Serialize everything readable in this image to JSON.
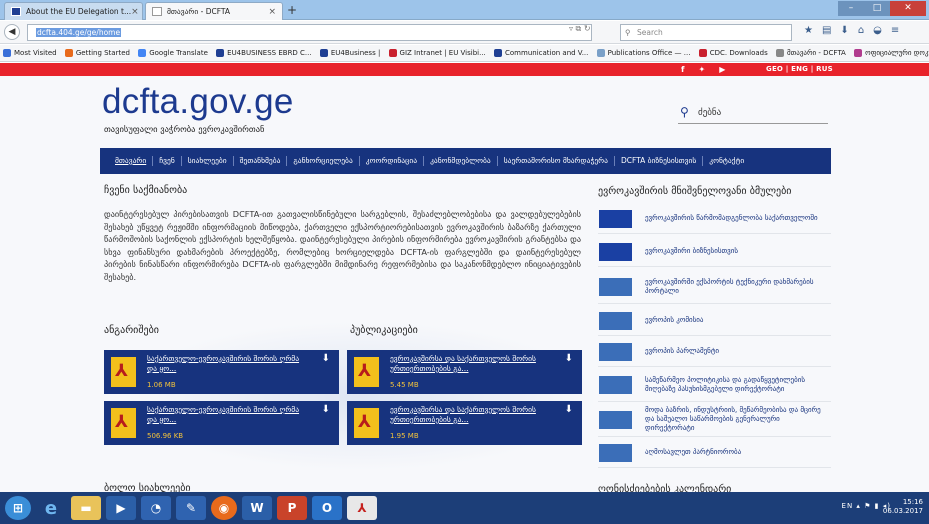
{
  "browser": {
    "tabs": [
      {
        "label": "About the EU Delegation t..."
      },
      {
        "label": "მთავარი - DCFTA"
      }
    ],
    "url": "dcfta.404.ge/ge/home",
    "search_placeholder": "Search",
    "bookmarks": [
      "Most Visited",
      "Getting Started",
      "Google Translate",
      "EU4BUSINESS EBRD C...",
      "EU4Business |",
      "GIZ Intranet | EU Visibi...",
      "Communication and V...",
      "Publications Office — ...",
      "CDC. Downloads",
      "მთავარი - DCFTA",
      "ოფიციალური დოკუ..."
    ]
  },
  "site": {
    "lang_switch": "GEO | ENG | RUS",
    "logo": "dcfta.gov.ge",
    "tagline": "თავისუფალი ვაჭრობა ევროკავშირთან",
    "search_label": "ძებნა",
    "nav": [
      "მთავარი",
      "ჩვენ",
      "სიახლეები",
      "შეთანხმება",
      "განხორციელება",
      "კოორდინაცია",
      "კანონმდებლობა",
      "საერთაშორისო მხარდაჭერა",
      "DCFTA ბიზნესისთვის",
      "კონტაქტი"
    ],
    "about_heading": "ჩვენი საქმიანობა",
    "about_text": "დაინტერესებულ პირებისათვის DCFTA-ით გათვალისწინებული სარგებლის, შესაძლებლობებისა და ვალდებულებების შესახებ უწყვეტ რეჟიმში ინფორმაციის მიწოდება, ქართველი ექსპორტიორებისათვის ევროკავშირის ბაზარზე ქართული წარმოშობის საქონლის ექსპორტის ხელშეწყობა. დაინტერესებული პირების ინფორმირება ევროკავშირის გრანტებსა და სხვა ფინანსური დახმარების პროექტებზე, რომლებიც ხორციელდება DCFTA-ის ფარგლებში და დაინტერესებულ პირების ნინასწარი ინფორმირება DCFTA-ის ფარგლებში მიმდინარე რეფორმებისა და საკანონმდებლო ინიციატივების შესახებ.",
    "reports_heading": "ანგარიშები",
    "pubs_heading": "პუბლიკაციები",
    "downloads": [
      {
        "title": "საქართველო-ევროკავშირის შორის ღრმა და ყო...",
        "size": "1.06 MB"
      },
      {
        "title": "ევროკავშირსა და საქართველოს შორის ურთიერთობების გა...",
        "size": "5.45 MB"
      },
      {
        "title": "საქართველო-ევროკავშირის შორის ღრმა და ყო...",
        "size": "506.96 KB"
      },
      {
        "title": "ევროკავშირსა და საქართველოს შორის ურთიერთობების გა...",
        "size": "1.95 MB"
      }
    ],
    "right_heading": "ევროკავშირის მნიშვნელოვანი ბმულები",
    "right_links": [
      "ევროკავშირის წარმომადგენლობა საქართველოში",
      "ევროკავშირი ბიზნესისთვის",
      "ევროკავშირში ექსპორტის ტექნიკური დახმარების პორტალი",
      "ევროპის კომისია",
      "ევროპის პარლამენტი",
      "სამეწარმეო პოლიტიკისა და გადაწყვეტილების მიღებაზე პასუხისმგებელი დირექტორატი",
      "მოდა ბაზრის, ინდუსტრიის, მეწარმეობისა და მცირე და საშუალო საწარმოების გენერალური დირექტორატი",
      "აღმოსავლეთ პარტნიორობა"
    ],
    "blog_heading": "ბოლო სიახლეები",
    "events_heading": "ღონისძიებების კალენდარი"
  },
  "taskbar": {
    "lang": "EN",
    "time": "15:16",
    "date": "06.03.2017"
  },
  "colors": {
    "brand": "#17337e",
    "red": "#e8232b",
    "size_text": "#f3c33b"
  }
}
